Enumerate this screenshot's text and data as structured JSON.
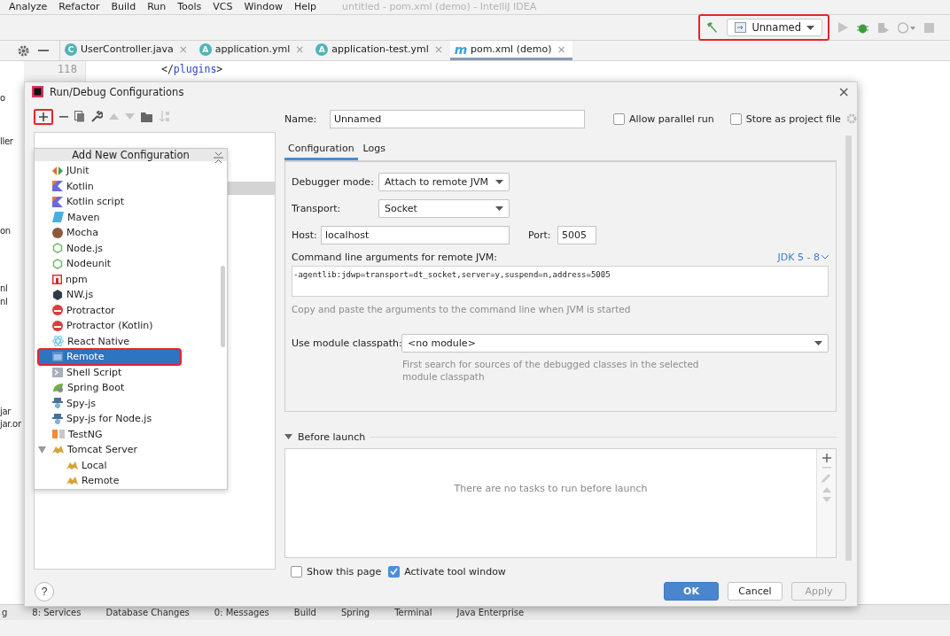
{
  "menu_bar": {
    "items": [
      "Analyze",
      "Refactor",
      "Build",
      "Run",
      "Tools",
      "VCS",
      "Window",
      "Help"
    ],
    "title": "untitled - pom.xml (demo) - IntelliJ IDEA"
  },
  "toolbar": {
    "run_config": "Unnamed",
    "highlighted": true
  },
  "editor_tabs": [
    {
      "badge": "C",
      "label": "UserController.java",
      "close": "×",
      "selected": false
    },
    {
      "badge": "A",
      "label": "application.yml",
      "close": "×",
      "selected": false
    },
    {
      "badge": "A",
      "label": "application-test.yml",
      "close": "×",
      "selected": false
    },
    {
      "badge": "m",
      "label": "pom.xml (demo)",
      "close": "×",
      "selected": true
    }
  ],
  "editor": {
    "line_number": "118",
    "code_open": "</",
    "code_tag": "plugins",
    "code_close": ">"
  },
  "project_fragments": [
    "o",
    "ller",
    "on",
    "nl",
    "nl",
    "jar",
    "jar.or"
  ],
  "dialog": {
    "title": "Run/Debug Configurations",
    "close": "×",
    "add_highlighted": true,
    "name_label": "Name:",
    "name_value": "Unnamed",
    "options": [
      {
        "label": "Allow parallel run",
        "checked": false
      },
      {
        "label": "Store as project file",
        "checked": false
      }
    ],
    "tabs": [
      {
        "label": "Configuration",
        "selected": true
      },
      {
        "label": "Logs",
        "selected": false
      }
    ],
    "debugger_mode": {
      "label": "Debugger mode:",
      "value": "Attach to remote JVM"
    },
    "transport": {
      "label": "Transport:",
      "value": "Socket"
    },
    "host": {
      "label": "Host:",
      "value": "localhost"
    },
    "port": {
      "label": "Port:",
      "value": "5005"
    },
    "cmd_label": "Command line arguments for remote JVM:",
    "jdk_link": "JDK 5 - 8",
    "cmd_value": "-agentlib:jdwp=transport=dt_socket,server=y,suspend=n,address=5005",
    "cmd_hint": "Copy and paste the arguments to the command line when JVM is started",
    "module": {
      "label": "Use module classpath:",
      "value": "<no module>",
      "hint": "First search for sources of the debugged classes in the selected module classpath"
    },
    "before_launch": {
      "label": "Before launch",
      "expanded": true,
      "empty_text": "There are no tasks to run before launch"
    },
    "bottom_options": [
      {
        "label": "Show this page",
        "checked": false
      },
      {
        "label": "Activate tool window",
        "checked": true
      }
    ],
    "help": "?",
    "buttons": [
      {
        "label": "OK",
        "kind": "primary"
      },
      {
        "label": "Cancel",
        "kind": "normal"
      },
      {
        "label": "Apply",
        "kind": "disabled"
      }
    ]
  },
  "add_config_popup": {
    "title": "Add New Configuration",
    "items": [
      {
        "label": "JUnit",
        "kind": "junit",
        "selected": false
      },
      {
        "label": "Kotlin",
        "kind": "kotlin",
        "selected": false
      },
      {
        "label": "Kotlin script",
        "kind": "kotlin",
        "selected": false
      },
      {
        "label": "Maven",
        "kind": "maven",
        "selected": false
      },
      {
        "label": "Mocha",
        "kind": "mocha",
        "selected": false
      },
      {
        "label": "Node.js",
        "kind": "node",
        "selected": false
      },
      {
        "label": "Nodeunit",
        "kind": "node",
        "selected": false
      },
      {
        "label": "npm",
        "kind": "npm",
        "selected": false
      },
      {
        "label": "NW.js",
        "kind": "nw",
        "selected": false
      },
      {
        "label": "Protractor",
        "kind": "protractor",
        "selected": false
      },
      {
        "label": "Protractor (Kotlin)",
        "kind": "protractor",
        "selected": false
      },
      {
        "label": "React Native",
        "kind": "react",
        "selected": false
      },
      {
        "label": "Remote",
        "kind": "remote",
        "selected": true,
        "highlighted": true
      },
      {
        "label": "Shell Script",
        "kind": "shell",
        "selected": false
      },
      {
        "label": "Spring Boot",
        "kind": "spring",
        "selected": false
      },
      {
        "label": "Spy-js",
        "kind": "spy",
        "selected": false
      },
      {
        "label": "Spy-js for Node.js",
        "kind": "spy",
        "selected": false
      },
      {
        "label": "TestNG",
        "kind": "testng",
        "selected": false
      },
      {
        "label": "Tomcat Server",
        "kind": "tomcat",
        "selected": false,
        "expanded": true,
        "children": [
          {
            "label": "Local",
            "kind": "tomcat",
            "selected": false
          },
          {
            "label": "Remote",
            "kind": "tomcat",
            "selected": false
          }
        ]
      }
    ]
  },
  "tool_window_bar": [
    "g",
    "8: Services",
    "Database Changes",
    "0: Messages",
    "Build",
    "Spring",
    "Terminal",
    "Java Enterprise"
  ]
}
